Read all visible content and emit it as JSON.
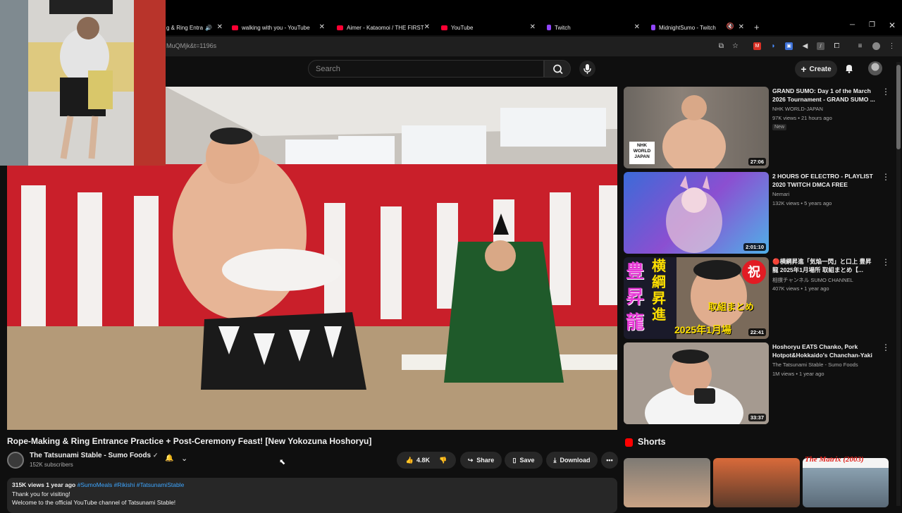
{
  "browser": {
    "tabs": [
      {
        "label": "g & Ring Entra",
        "favicon": "speaker-icon",
        "color": "#bbbbbb",
        "audio": true
      },
      {
        "label": "walking with you - YouTube",
        "favicon": "youtube-icon",
        "color": "#ff0033"
      },
      {
        "label": "Aimer - Kataomoi / THE FIRST T",
        "favicon": "youtube-icon",
        "color": "#ff0033"
      },
      {
        "label": "YouTube",
        "favicon": "youtube-icon",
        "color": "#ff0033"
      },
      {
        "label": "Twitch",
        "favicon": "twitch-icon",
        "color": "#9146ff"
      },
      {
        "label": "MidnightSumo - Twitch",
        "favicon": "twitch-icon",
        "color": "#9146ff",
        "muted": true
      }
    ],
    "new_tab": "+",
    "url": "MuQMjk&t=1196s"
  },
  "youtube": {
    "search_placeholder": "Search",
    "create_label": "Create",
    "video": {
      "title": "Rope-Making & Ring Entrance Practice + Post-Ceremony Feast! [New Yokozuna Hoshoryu]",
      "channel": "The Tatsunami Stable - Sumo Foods",
      "subscribers": "152K subscribers",
      "likes": "4.8K",
      "share": "Share",
      "save": "Save",
      "download": "Download",
      "views_date": "315K views  1 year ago",
      "tags": "#SumoMeals #Rikishi #TatsunamiStable",
      "desc_lines": [
        "Thank you for visiting!",
        "Welcome to the official YouTube channel of Tatsunami Stable!"
      ]
    },
    "recommendations": [
      {
        "title": "GRAND SUMO: Day 1 of the March 2026 Tournament - GRAND SUMO ...",
        "channel": "NHK WORLD-JAPAN",
        "meta": "97K views • 21 hours ago",
        "badge": "New",
        "duration": "27:06",
        "thumb_logo": "NHK WORLD JAPAN"
      },
      {
        "title": "2 HOURS OF ELECTRO - PLAYLIST 2020 TWITCH DMCA FREE",
        "channel": "Nemari",
        "meta": "132K views • 5 years ago",
        "duration": "2:01:10"
      },
      {
        "title": "🔴横綱昇進「気焔一閃」と口上 豊昇龍 2025年1月場所 取組まとめ【...",
        "channel": "相撲チャンネル SUMO CHANNEL",
        "meta": "407K views • 1 year ago",
        "duration": "22:41",
        "thumb_text": [
          "豊",
          "昇",
          "龍",
          "横",
          "綱",
          "昇",
          "進",
          "祝",
          "取組まとめ",
          "2025年1月場"
        ]
      },
      {
        "title": "Hoshoryu EATS Chanko, Pork Hotpot&Hokkaido's Chanchan-Yaki ...",
        "channel": "The Tatsunami Stable - Sumo Foods",
        "meta": "1M views • 1 year ago",
        "duration": "33:37"
      }
    ],
    "shorts_header": "Shorts",
    "shorts_overlay_text": "The Matrix (2003)"
  },
  "colors": {
    "bg": "#0f0f0f",
    "accent_red": "#ff0033",
    "twitch": "#9146ff",
    "link": "#3ea6ff"
  }
}
